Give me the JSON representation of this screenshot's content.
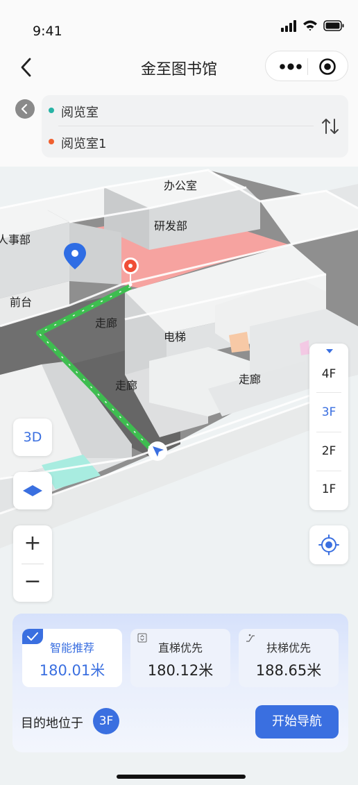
{
  "status_bar": {
    "time": "9:41"
  },
  "header": {
    "title": "金至图书馆"
  },
  "route": {
    "origin": "阅览室",
    "destination": "阅览室1"
  },
  "map_labels": {
    "office": "办公室",
    "rnd": "研发部",
    "hr": "人事部",
    "reception": "前台",
    "corridor_a": "走廊",
    "elevator": "电梯",
    "corridor_b": "走廊",
    "corridor_c": "走廊"
  },
  "controls": {
    "view_mode": "3D",
    "zoom_in": "+",
    "zoom_out": "−"
  },
  "floors": {
    "items": [
      "4F",
      "3F",
      "2F",
      "1F"
    ],
    "active": "3F"
  },
  "route_options": [
    {
      "label": "智能推荐",
      "distance": "180.01米",
      "selected": true
    },
    {
      "label": "直梯优先",
      "distance": "180.12米",
      "selected": false
    },
    {
      "label": "扶梯优先",
      "distance": "188.65米",
      "selected": false
    }
  ],
  "destination_info": {
    "label": "目的地位于",
    "floor": "3F"
  },
  "start_button": "开始导航",
  "colors": {
    "accent": "#3a6fe0",
    "route": "#3ebd50",
    "highlight_room": "#f6a3a0",
    "origin_dot": "#27b3a5",
    "destination_dot": "#f0602f"
  }
}
